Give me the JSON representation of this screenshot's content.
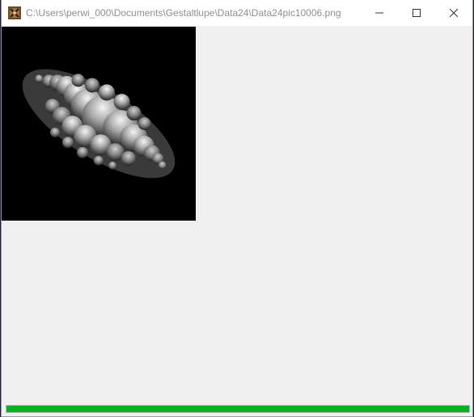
{
  "window": {
    "title": "C:\\Users\\perwi_000\\Documents\\Gestaltlupe\\Data24\\Data24pic10006.png",
    "icon": "app-icon"
  },
  "controls": {
    "minimize": "minimize-icon",
    "maximize": "maximize-icon",
    "close": "close-icon"
  },
  "image": {
    "subject": "grayscale 3D fractal render on black background"
  },
  "progress": {
    "value_percent": 100,
    "color": "#06b025"
  }
}
